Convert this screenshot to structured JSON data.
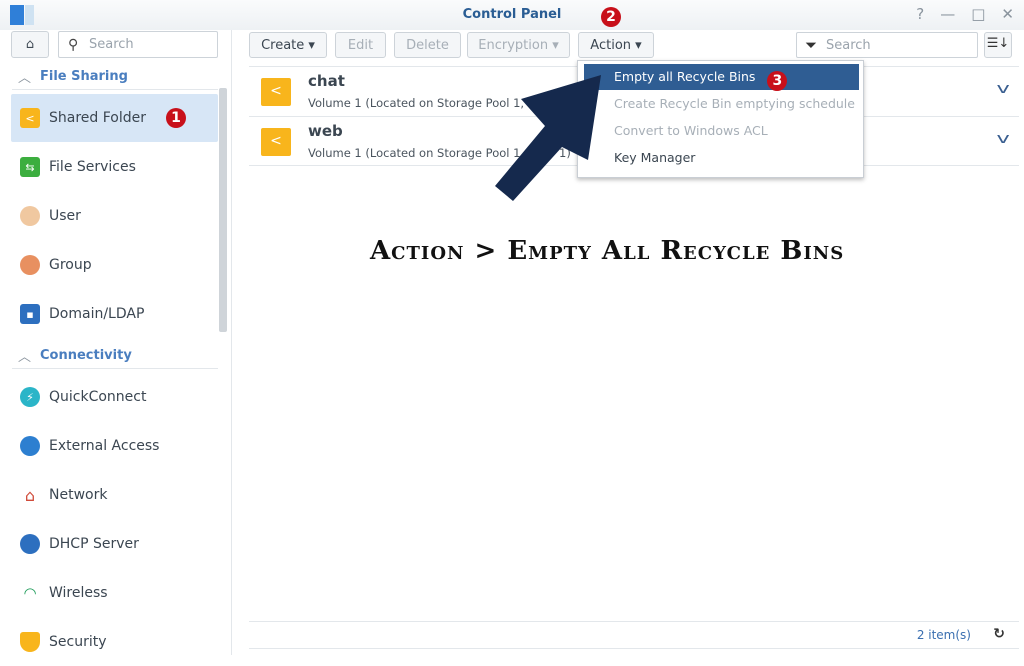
{
  "window": {
    "title": "Control Panel",
    "help": "?",
    "minimize": "—",
    "maximize": "□",
    "close": "✕"
  },
  "sidebar": {
    "search_placeholder": "Search",
    "sections": [
      {
        "label": "File Sharing"
      },
      {
        "label": "Connectivity"
      }
    ],
    "items": [
      {
        "label": "Shared Folder",
        "selected": true
      },
      {
        "label": "File Services"
      },
      {
        "label": "User"
      },
      {
        "label": "Group"
      },
      {
        "label": "Domain/LDAP"
      },
      {
        "label": "QuickConnect"
      },
      {
        "label": "External Access"
      },
      {
        "label": "Network"
      },
      {
        "label": "DHCP Server"
      },
      {
        "label": "Wireless"
      },
      {
        "label": "Security"
      }
    ]
  },
  "toolbar": {
    "create": "Create",
    "edit": "Edit",
    "delete": "Delete",
    "encryption": "Encryption",
    "action": "Action",
    "search_placeholder": "Search"
  },
  "folders": [
    {
      "name": "chat",
      "desc": "Volume 1 (Located on Storage Pool 1, RAID 1)"
    },
    {
      "name": "web",
      "desc": "Volume 1 (Located on Storage Pool 1, RAID 1)"
    }
  ],
  "action_menu": [
    {
      "label": "Empty all Recycle Bins",
      "highlighted": true
    },
    {
      "label": "Create Recycle Bin emptying schedule",
      "disabled": true
    },
    {
      "label": "Convert to Windows ACL",
      "disabled": true
    },
    {
      "label": "Key Manager"
    }
  ],
  "annotations": {
    "step1": "1",
    "step2": "2",
    "step3": "3",
    "caption": "Action > Empty All Recycle Bins",
    "arrow_color": "#15294d"
  },
  "footer": {
    "count": "2 item(s)"
  }
}
